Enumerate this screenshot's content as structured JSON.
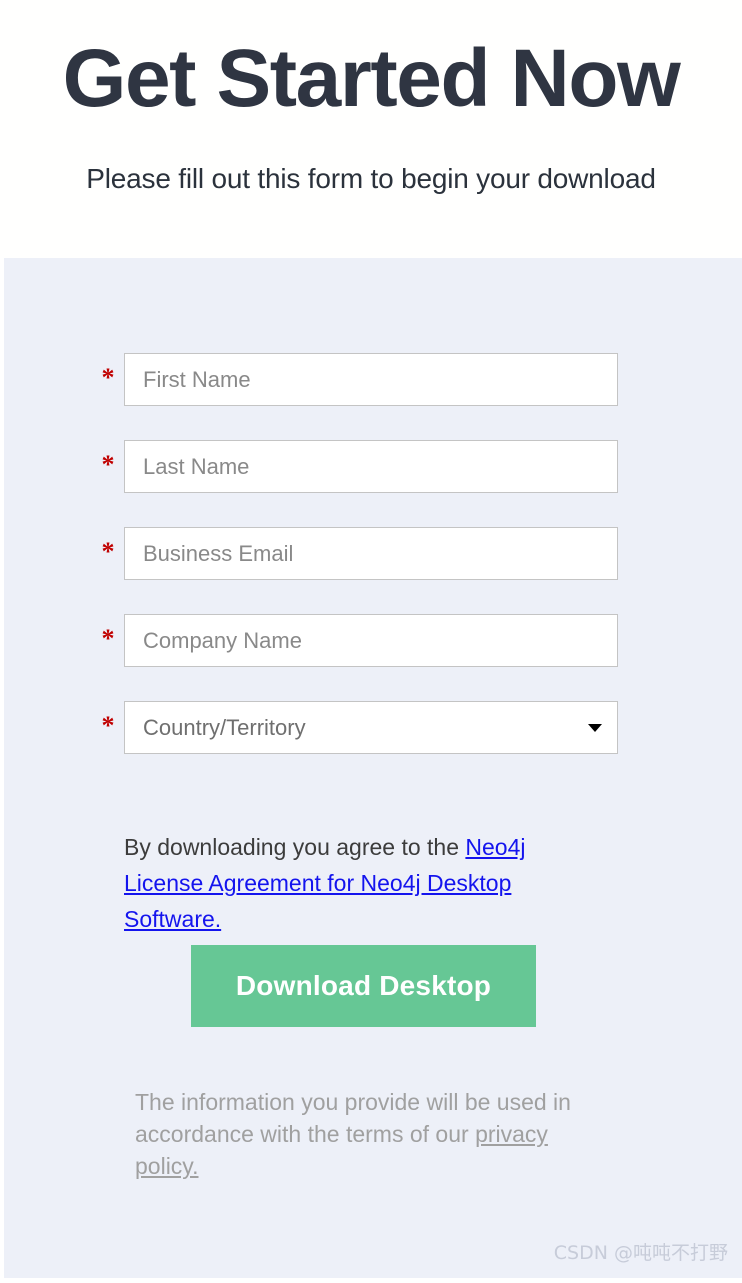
{
  "hero": {
    "title": "Get Started Now",
    "subtitle": "Please fill out this form to begin your download"
  },
  "form": {
    "required_marker": "*",
    "fields": [
      {
        "name": "first-name",
        "placeholder": "First Name",
        "value": "",
        "type": "text",
        "required": true
      },
      {
        "name": "last-name",
        "placeholder": "Last Name",
        "value": "",
        "type": "text",
        "required": true
      },
      {
        "name": "business-email",
        "placeholder": "Business Email",
        "value": "",
        "type": "email",
        "required": true
      },
      {
        "name": "company-name",
        "placeholder": "Company Name",
        "value": "",
        "type": "text",
        "required": true
      },
      {
        "name": "country",
        "placeholder": "Country/Territory",
        "value": "Country/Territory",
        "type": "select",
        "required": true
      }
    ],
    "country_selected": "Country/Territory",
    "agreement": {
      "lead": "By downloading you agree to the ",
      "link_text": "Neo4j License Agreement for Neo4j Desktop Software."
    },
    "submit_label": "Download Desktop",
    "disclaimer": {
      "lead": "The information you provide will be used in accordance with the terms of our ",
      "link_text": "privacy policy."
    }
  },
  "watermark": "CSDN @吨吨不打野",
  "colors": {
    "title": "#2f3542",
    "panel_background": "#edf0f8",
    "page_background": "#ffffff",
    "required_star": "#c00000",
    "link": "#1414ee",
    "button": "#66c795",
    "button_text": "#ffffff",
    "placeholder": "#898989",
    "input_border": "#c4c4c4",
    "disclaimer_text": "#a0a0a0",
    "watermark": "#c7ccd9"
  }
}
